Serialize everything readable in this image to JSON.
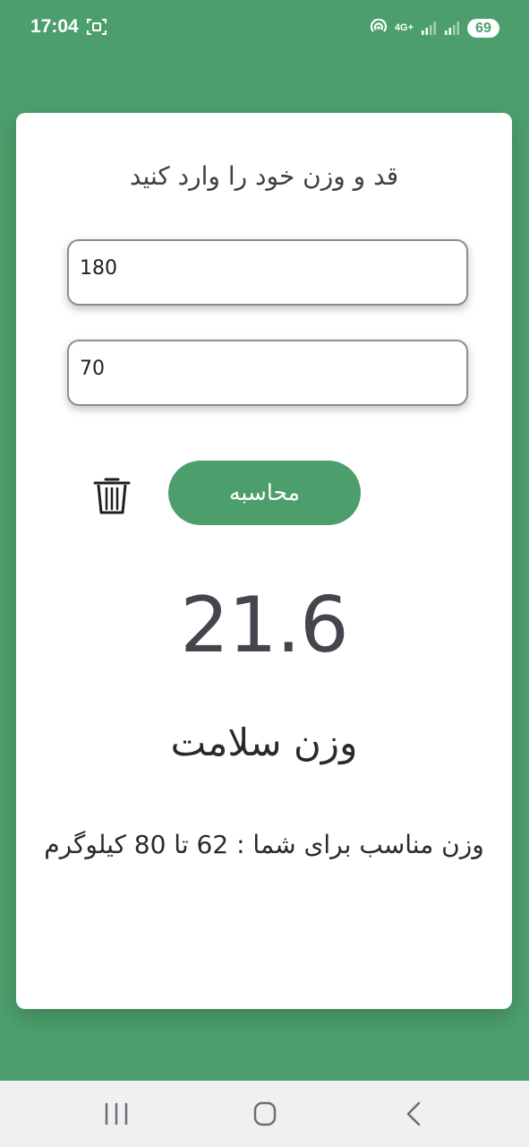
{
  "status_bar": {
    "time": "17:04",
    "battery": "69",
    "network": "4G+",
    "icons": [
      "screenshot-icon",
      "hotspot-icon",
      "signal-icon",
      "signal-icon",
      "battery-icon"
    ]
  },
  "form": {
    "title": "قد و وزن خود را وارد کنید",
    "height_value": "180",
    "weight_value": "70",
    "calculate_label": "محاسبه",
    "delete_icon": "trash-icon"
  },
  "result": {
    "bmi": "21.6",
    "status": "وزن سلامت",
    "ideal_weight": "وزن مناسب برای شما : 62 تا 80 کیلوگرم"
  },
  "navigation": {
    "icons": [
      "recent-apps-icon",
      "home-icon",
      "back-icon"
    ]
  },
  "colors": {
    "accent": "#4c9f6c",
    "card": "#ffffff",
    "nav_bar": "#eef0f1",
    "text": "#2a2a2a"
  }
}
